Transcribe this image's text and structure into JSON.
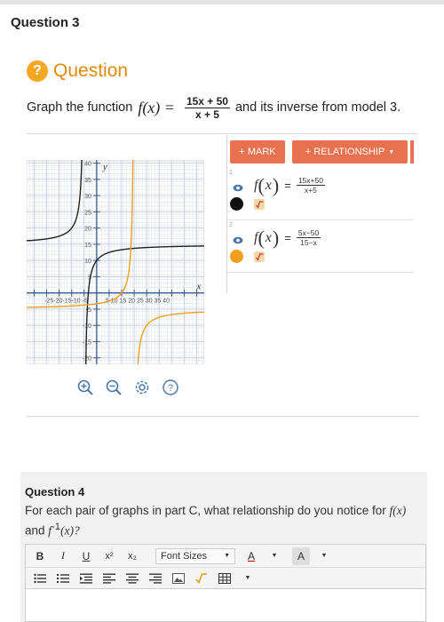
{
  "question3": {
    "header": "Question 3",
    "badge": "?",
    "title": "Question",
    "prompt_before": "Graph the function",
    "prompt_fx": "f(x) =",
    "prompt_num": "15x + 50",
    "prompt_den": "x + 5",
    "prompt_after": "and its inverse from model 3."
  },
  "graph": {
    "y_axis_label": "y",
    "x_axis_label": "x",
    "y_ticks": [
      "40",
      "35",
      "30",
      "25",
      "20",
      "15",
      "10",
      "5",
      "-5",
      "-10",
      "-15",
      "-20"
    ],
    "x_ticks_left": "-25-20-15-10 -5",
    "x_ticks_right": "5 10 15 20 25 30 35 40",
    "series": [
      {
        "color": "#222222",
        "expr": "(15x+50)/(x+5)"
      },
      {
        "color": "#f0a01c",
        "expr": "(5x-50)/(15-x)"
      }
    ]
  },
  "tools": {
    "zoom_in": "zoom-in-icon",
    "zoom_out": "zoom-out-icon",
    "settings": "settings-icon",
    "help": "?"
  },
  "panel": {
    "mark_label": "+ MARK",
    "relationship_label": "+ RELATIONSHIP",
    "accent_color": "#e8714f",
    "functions": [
      {
        "index": "1",
        "color": "#111111",
        "lhs_f": "f",
        "lhs_x": "x",
        "eq": "=",
        "num": "15x+50",
        "den": "x+5"
      },
      {
        "index": "2",
        "color": "#f0a01c",
        "lhs_f": "f",
        "lhs_x": "x",
        "eq": "=",
        "num": "5x−50",
        "den": "15−x"
      }
    ]
  },
  "question4": {
    "title": "Question 4",
    "text_before": "For each pair of graphs in part C, what relationship do you notice for ",
    "fx": "f(x)",
    "and": " and ",
    "finv": "f",
    "finv_sup": "-1",
    "finv_arg": "(x)?"
  },
  "editor": {
    "bold": "B",
    "italic": "I",
    "underline": "U",
    "superscript": "x²",
    "subscript": "x₂",
    "font_sizes": "Font Sizes",
    "text_color": "A",
    "bg_color": "A"
  }
}
